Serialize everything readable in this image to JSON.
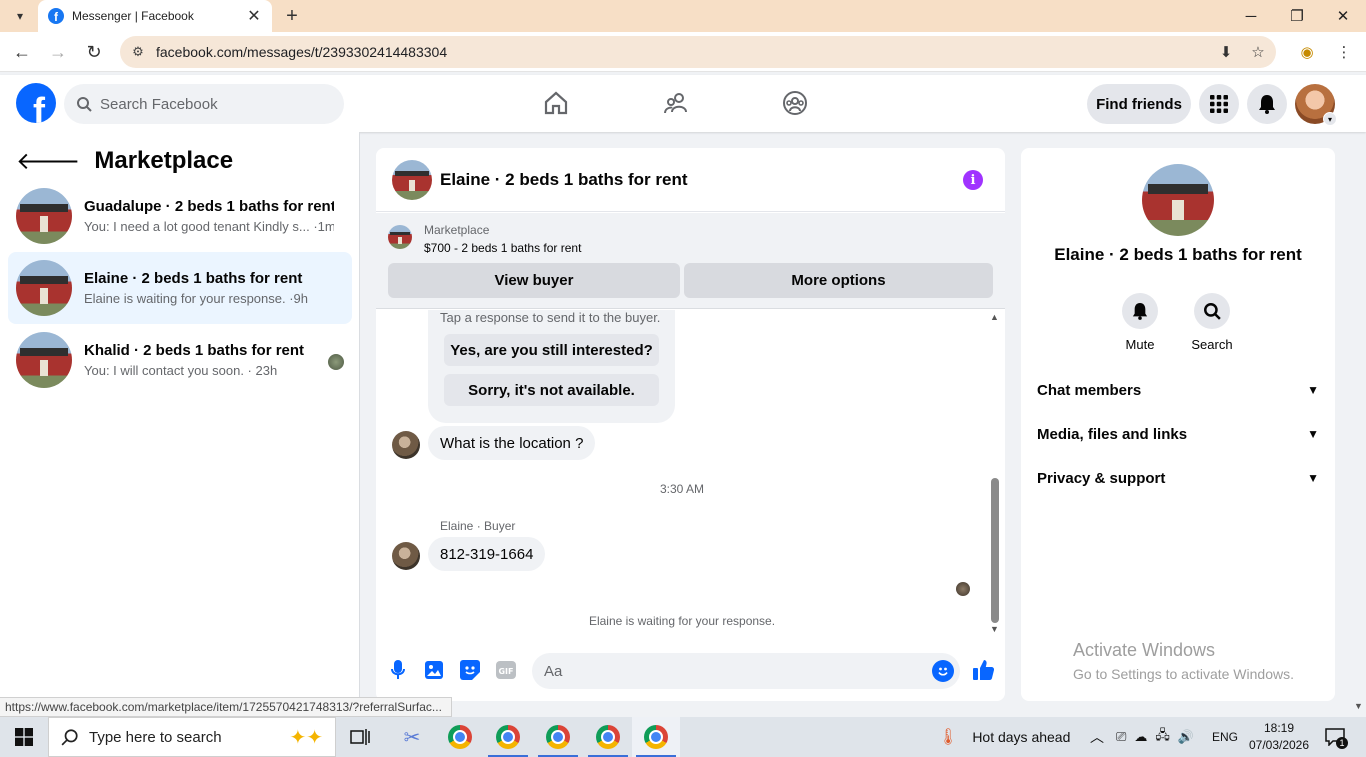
{
  "browser": {
    "tab_title": "Messenger | Facebook",
    "url": "facebook.com/messages/t/2393302414483304",
    "status_url": "https://www.facebook.com/marketplace/item/1725570421748313/?referralSurfac..."
  },
  "header": {
    "search_placeholder": "Search Facebook",
    "find_friends_label": "Find friends"
  },
  "left_panel": {
    "title": "Marketplace",
    "conversations": [
      {
        "name": "Guadalupe · 2 beds 1 baths for rent",
        "preview": "You: I need a lot good tenant Kindly s... ·1m"
      },
      {
        "name": "Elaine · 2 beds 1 baths for rent",
        "preview": "Elaine is waiting for your response. ·9h"
      },
      {
        "name": "Khalid · 2 beds 1 baths for rent",
        "preview": "You: I will contact you soon. · 23h"
      }
    ]
  },
  "chat": {
    "title": "Elaine · 2 beds 1 baths for rent",
    "marketplace_label": "Marketplace",
    "listing": "$700 - 2 beds 1 baths for rent",
    "view_buyer_label": "View buyer",
    "more_options_label": "More options",
    "quick_hint": "Tap a response to send it to the buyer.",
    "quick_replies": [
      "Yes, are you still interested?",
      "Sorry, it's not available."
    ],
    "message_1": "What is the location ?",
    "timestamp": "3:30 AM",
    "sender_label": "Elaine · Buyer",
    "message_2": "812-319-1664",
    "waiting_note": "Elaine is waiting for your response.",
    "composer_placeholder": "Aa"
  },
  "right_panel": {
    "title": "Elaine · 2 beds 1 baths for rent",
    "mute_label": "Mute",
    "search_label": "Search",
    "sections": [
      "Chat members",
      "Media, files and links",
      "Privacy & support"
    ],
    "watermark_title": "Activate Windows",
    "watermark_sub": "Go to Settings to activate Windows."
  },
  "taskbar": {
    "search_placeholder": "Type here to search",
    "weather": "Hot days ahead",
    "lang": "ENG",
    "time": "18:19",
    "date": "07/03/2026",
    "notification_count": "1"
  },
  "colors": {
    "brand": "#0866ff",
    "messenger_accent": "#a033ff",
    "active_row": "#ebf5ff"
  }
}
